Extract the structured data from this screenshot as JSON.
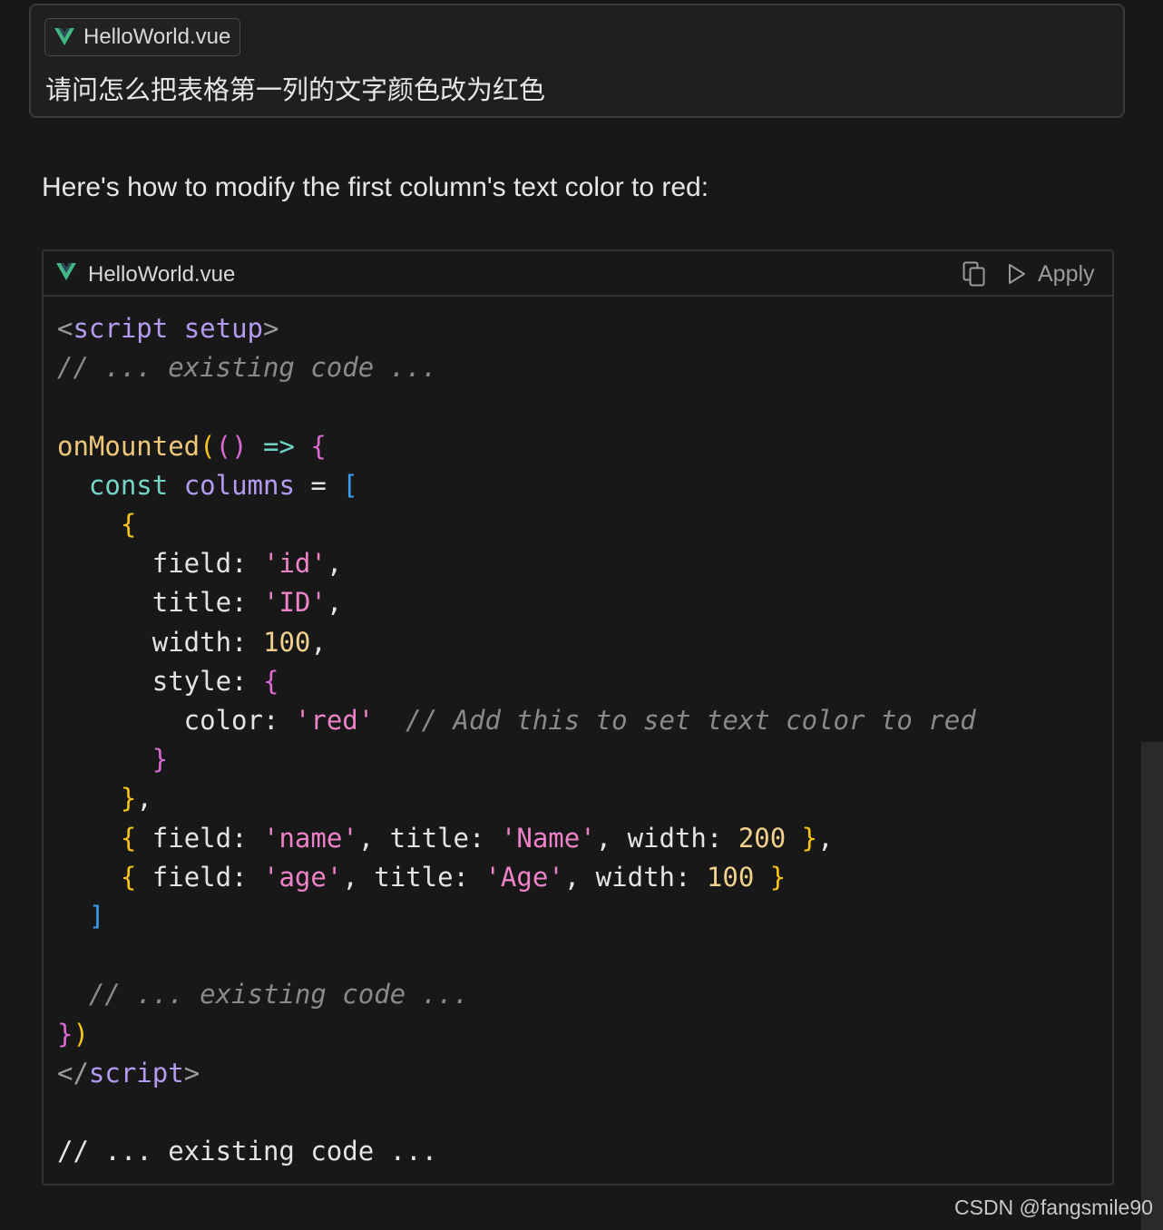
{
  "prompt": {
    "file_chip": "HelloWorld.vue",
    "text": "请问怎么把表格第一列的文字颜色改为红色"
  },
  "reply": {
    "text": "Here's how to modify the first column's text color to red:"
  },
  "code_block": {
    "filename": "HelloWorld.vue",
    "apply_label": "Apply",
    "icons": [
      "vue-icon",
      "copy-icon",
      "play-icon"
    ]
  },
  "code_lines": [
    [
      [
        "tag",
        "<"
      ],
      [
        "kw",
        "script"
      ],
      [
        "plain",
        " "
      ],
      [
        "kw",
        "setup"
      ],
      [
        "tag",
        ">"
      ]
    ],
    [
      [
        "cm",
        "// ... existing code ..."
      ]
    ],
    [],
    [
      [
        "fn",
        "onMounted"
      ],
      [
        "pn1",
        "("
      ],
      [
        "pn2",
        "()"
      ],
      [
        "plain",
        " "
      ],
      [
        "op",
        "=>"
      ],
      [
        "plain",
        " "
      ],
      [
        "pn2",
        "{"
      ]
    ],
    [
      [
        "plain",
        "  "
      ],
      [
        "const",
        "const"
      ],
      [
        "plain",
        " "
      ],
      [
        "var",
        "columns"
      ],
      [
        "plain",
        " = "
      ],
      [
        "pn3",
        "["
      ]
    ],
    [
      [
        "plain",
        "    "
      ],
      [
        "pn1",
        "{"
      ]
    ],
    [
      [
        "plain",
        "      field: "
      ],
      [
        "str",
        "'id'"
      ],
      [
        "plain",
        ","
      ]
    ],
    [
      [
        "plain",
        "      title: "
      ],
      [
        "str",
        "'ID'"
      ],
      [
        "plain",
        ","
      ]
    ],
    [
      [
        "plain",
        "      width: "
      ],
      [
        "num",
        "100"
      ],
      [
        "plain",
        ","
      ]
    ],
    [
      [
        "plain",
        "      style: "
      ],
      [
        "pn2",
        "{"
      ]
    ],
    [
      [
        "plain",
        "        color: "
      ],
      [
        "str",
        "'red'"
      ],
      [
        "plain",
        "  "
      ],
      [
        "cm",
        "// Add this to set text color to red"
      ]
    ],
    [
      [
        "plain",
        "      "
      ],
      [
        "pn2",
        "}"
      ]
    ],
    [
      [
        "plain",
        "    "
      ],
      [
        "pn1",
        "}"
      ],
      [
        "plain",
        ","
      ]
    ],
    [
      [
        "plain",
        "    "
      ],
      [
        "pn1",
        "{"
      ],
      [
        "plain",
        " field: "
      ],
      [
        "str",
        "'name'"
      ],
      [
        "plain",
        ", title: "
      ],
      [
        "str",
        "'Name'"
      ],
      [
        "plain",
        ", width: "
      ],
      [
        "num",
        "200"
      ],
      [
        "plain",
        " "
      ],
      [
        "pn1",
        "}"
      ],
      [
        "plain",
        ","
      ]
    ],
    [
      [
        "plain",
        "    "
      ],
      [
        "pn1",
        "{"
      ],
      [
        "plain",
        " field: "
      ],
      [
        "str",
        "'age'"
      ],
      [
        "plain",
        ", title: "
      ],
      [
        "str",
        "'Age'"
      ],
      [
        "plain",
        ", width: "
      ],
      [
        "num",
        "100"
      ],
      [
        "plain",
        " "
      ],
      [
        "pn1",
        "}"
      ]
    ],
    [
      [
        "plain",
        "  "
      ],
      [
        "pn3",
        "]"
      ]
    ],
    [],
    [
      [
        "plain",
        "  "
      ],
      [
        "cm",
        "// ... existing code ..."
      ]
    ],
    [
      [
        "pn2",
        "}"
      ],
      [
        "pn1",
        ")"
      ]
    ],
    [
      [
        "tag",
        "</"
      ],
      [
        "kw",
        "script"
      ],
      [
        "tag",
        ">"
      ]
    ],
    [],
    [
      [
        "plain",
        "// ... existing code ..."
      ]
    ]
  ],
  "watermark": "CSDN @fangsmile90",
  "colors": {
    "background": "#181818",
    "vue_green": "#41b883",
    "keyword": "#b29bf0",
    "string": "#ee82c9",
    "number": "#f0d08c",
    "comment": "#8a8a8a"
  }
}
